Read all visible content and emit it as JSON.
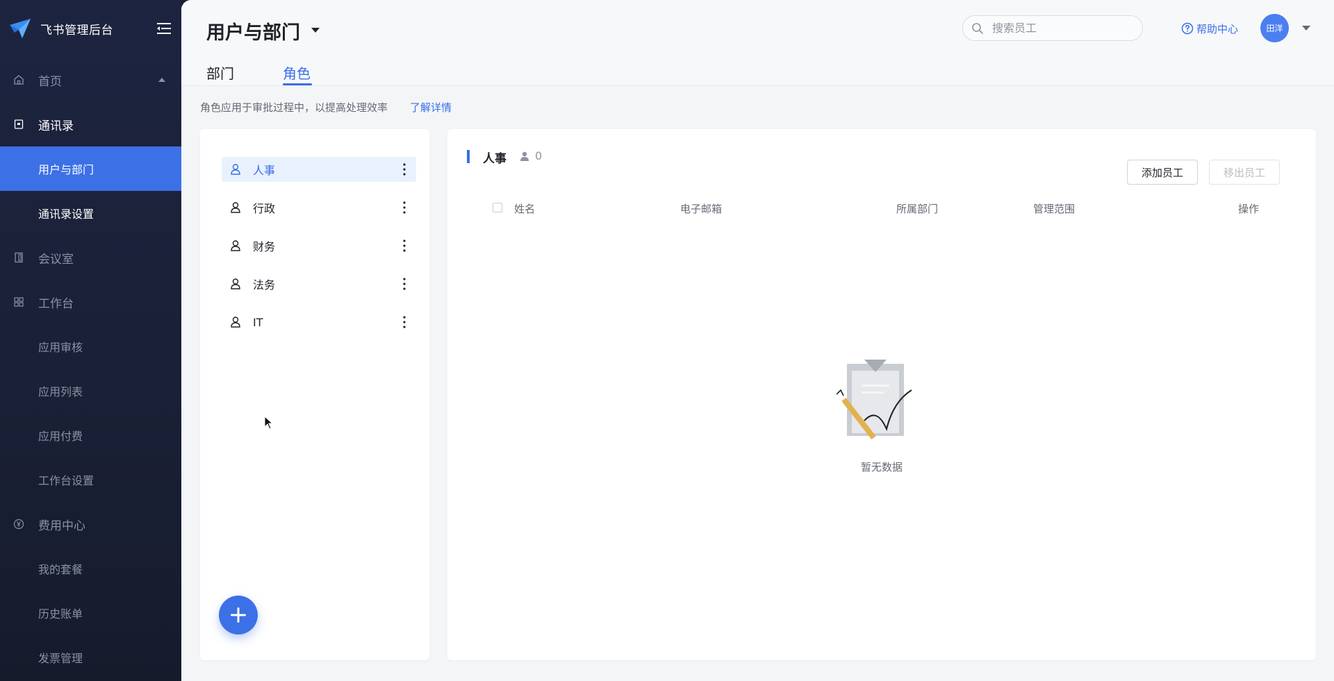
{
  "sidebar": {
    "brand_title": "飞书管理后台",
    "items": [
      {
        "label": "首页",
        "icon": "home-icon"
      },
      {
        "label": "通讯录",
        "icon": "contacts-icon"
      },
      {
        "label": "用户与部门"
      },
      {
        "label": "通讯录设置"
      },
      {
        "label": "会议室",
        "icon": "door-icon"
      },
      {
        "label": "工作台",
        "icon": "grid-icon"
      },
      {
        "label": "应用审核"
      },
      {
        "label": "应用列表"
      },
      {
        "label": "应用付费"
      },
      {
        "label": "工作台设置"
      },
      {
        "label": "费用中心",
        "icon": "yen-icon"
      },
      {
        "label": "我的套餐"
      },
      {
        "label": "历史账单"
      },
      {
        "label": "发票管理"
      }
    ]
  },
  "header": {
    "page_title": "用户与部门",
    "search_placeholder": "搜索员工",
    "help_label": "帮助中心",
    "user_name": "田洋"
  },
  "tabs": [
    {
      "label": "部门"
    },
    {
      "label": "角色"
    }
  ],
  "hint": {
    "text": "角色应用于审批过程中，以提高处理效率",
    "link": "了解详情"
  },
  "roles": [
    {
      "label": "人事"
    },
    {
      "label": "行政"
    },
    {
      "label": "财务"
    },
    {
      "label": "法务"
    },
    {
      "label": "IT"
    }
  ],
  "members": {
    "role_title": "人事",
    "count": "0",
    "add_button": "添加员工",
    "remove_button": "移出员工",
    "columns": [
      "姓名",
      "电子邮箱",
      "所属部门",
      "管理范围",
      "操作"
    ],
    "empty_text": "暂无数据"
  },
  "colors": {
    "accent": "#3a6ee8",
    "sidebar_active": "#3c70e6",
    "sidebar_bg": "#1d2440"
  }
}
